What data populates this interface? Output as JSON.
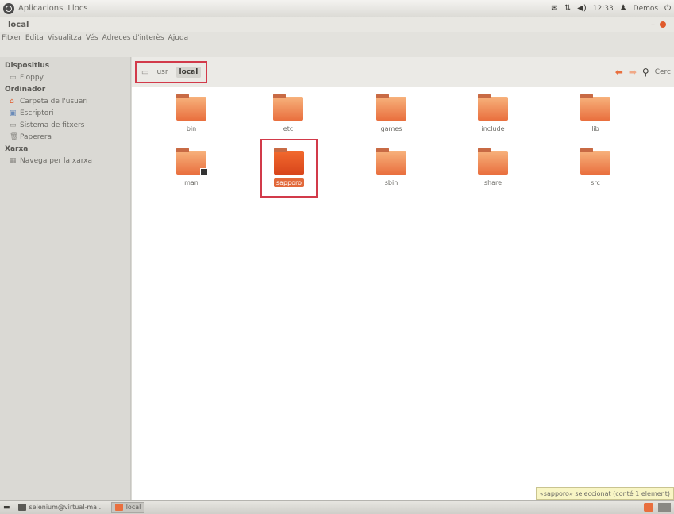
{
  "top_panel": {
    "menus": [
      "Aplicacions",
      "Llocs"
    ],
    "tray": {
      "time": "12:33",
      "user": "Demos"
    }
  },
  "window": {
    "title": "local"
  },
  "menubar": [
    "Fitxer",
    "Edita",
    "Visualitza",
    "Vés",
    "Adreces d'interès",
    "Ajuda"
  ],
  "sidebar": {
    "sections": [
      {
        "heading": "Dispositius",
        "items": [
          {
            "label": "Floppy",
            "icon": "floppy-icon"
          }
        ]
      },
      {
        "heading": "Ordinador",
        "items": [
          {
            "label": "Carpeta de l'usuari",
            "icon": "home-folder-icon"
          },
          {
            "label": "Escriptori",
            "icon": "desktop-icon"
          },
          {
            "label": "Sistema de fitxers",
            "icon": "drive-icon"
          },
          {
            "label": "Paperera",
            "icon": "trash-icon"
          }
        ]
      },
      {
        "heading": "Xarxa",
        "items": [
          {
            "label": "Navega per la xarxa",
            "icon": "network-icon"
          }
        ]
      }
    ]
  },
  "breadcrumb": [
    "usr",
    "local"
  ],
  "search_label": "Cerc",
  "folders": [
    {
      "name": "bin"
    },
    {
      "name": "etc"
    },
    {
      "name": "games"
    },
    {
      "name": "include"
    },
    {
      "name": "lib"
    },
    {
      "name": "man"
    },
    {
      "name": "sapporo"
    },
    {
      "name": "sbin"
    },
    {
      "name": "share"
    },
    {
      "name": "src"
    }
  ],
  "status": "«sapporo» seleccionat (conté 1 element)",
  "taskbar": {
    "tasks": [
      "selenium@virtual-ma...",
      "local"
    ]
  },
  "colors": {
    "accent": "#e96f3e",
    "highlight": "#d23a4a",
    "selection": "#e2693a"
  }
}
